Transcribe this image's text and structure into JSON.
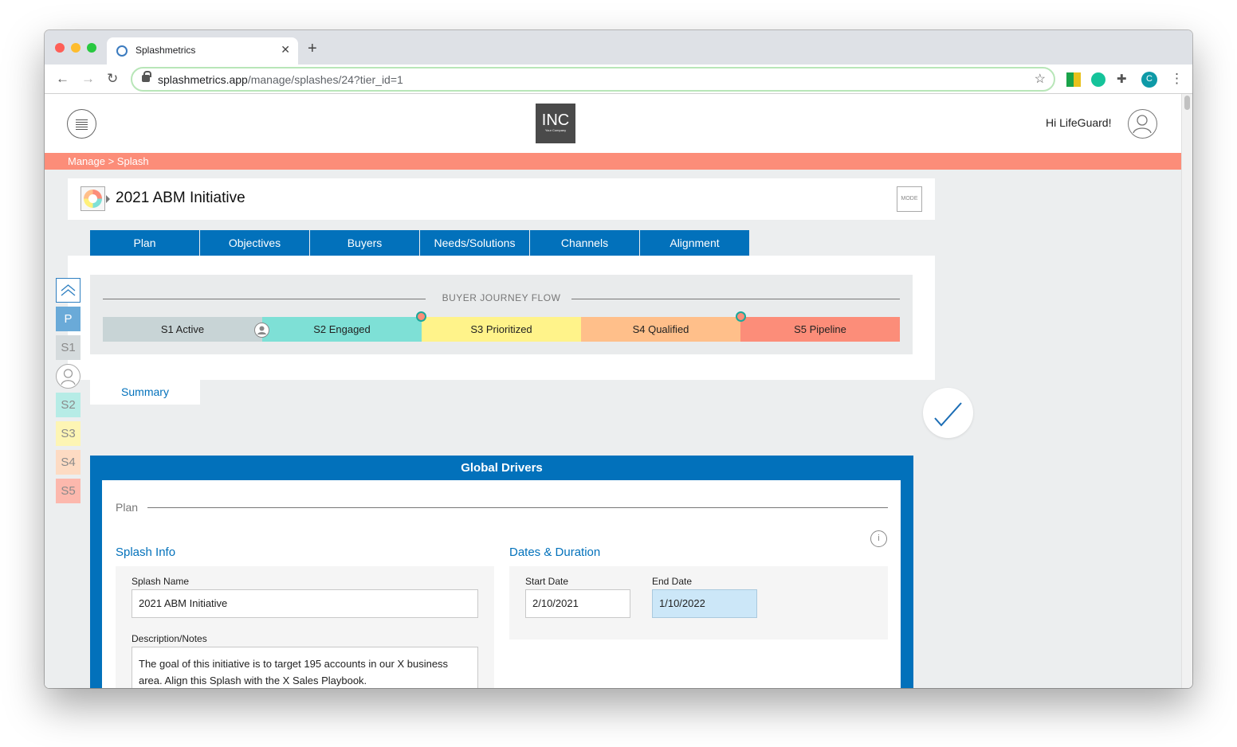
{
  "browser": {
    "tab_title": "Splashmetrics",
    "url_domain": "splashmetrics.app",
    "url_path": "/manage/splashes/24?tier_id=1",
    "profile_initial": "C"
  },
  "header": {
    "logo_text": "INC",
    "logo_subtext": "Your Company",
    "greeting": "Hi LifeGuard!"
  },
  "breadcrumb": "Manage > Splash",
  "splash": {
    "title": "2021 ABM Initiative",
    "mode_label": "MODE"
  },
  "tabs": [
    "Plan",
    "Objectives",
    "Buyers",
    "Needs/Solutions",
    "Channels",
    "Alignment"
  ],
  "journey": {
    "title": "BUYER JOURNEY FLOW",
    "stages": [
      {
        "label": "S1 Active",
        "color": "#c8d4d6"
      },
      {
        "label": "S2 Engaged",
        "color": "#7ee0d6"
      },
      {
        "label": "S3 Prioritized",
        "color": "#fff38a"
      },
      {
        "label": "S4 Qualified",
        "color": "#ffbf8a"
      },
      {
        "label": "S5 Pipeline",
        "color": "#fc8d79"
      }
    ]
  },
  "summary_tab": "Summary",
  "sidebar": {
    "items": [
      {
        "label": "P",
        "color": "#6aaad8",
        "text_color": "#ffffff"
      },
      {
        "label": "S1",
        "color": "#d5dbdd",
        "text_color": "#8a8a8a"
      },
      {
        "label": "S2",
        "color": "#b6ece6",
        "text_color": "#8a8a8a"
      },
      {
        "label": "S3",
        "color": "#fdf5b4",
        "text_color": "#8a8a8a"
      },
      {
        "label": "S4",
        "color": "#fddbc3",
        "text_color": "#8a8a8a"
      },
      {
        "label": "S5",
        "color": "#fcb8ad",
        "text_color": "#8a8a8a"
      }
    ]
  },
  "drivers": {
    "title": "Global Drivers",
    "section_label": "Plan",
    "splash_info": {
      "title": "Splash Info",
      "name_label": "Splash Name",
      "name_value": "2021 ABM Initiative",
      "desc_label": "Description/Notes",
      "desc_value": "The goal of this initiative is to target 195 accounts in our X business area. Align this Splash with the X Sales Playbook."
    },
    "dates": {
      "title": "Dates & Duration",
      "start_label": "Start Date",
      "start_value": "2/10/2021",
      "end_label": "End Date",
      "end_value": "1/10/2022"
    }
  },
  "colors": {
    "brand_blue": "#0271bb",
    "breadcrumb_bar": "#fc8d79"
  }
}
